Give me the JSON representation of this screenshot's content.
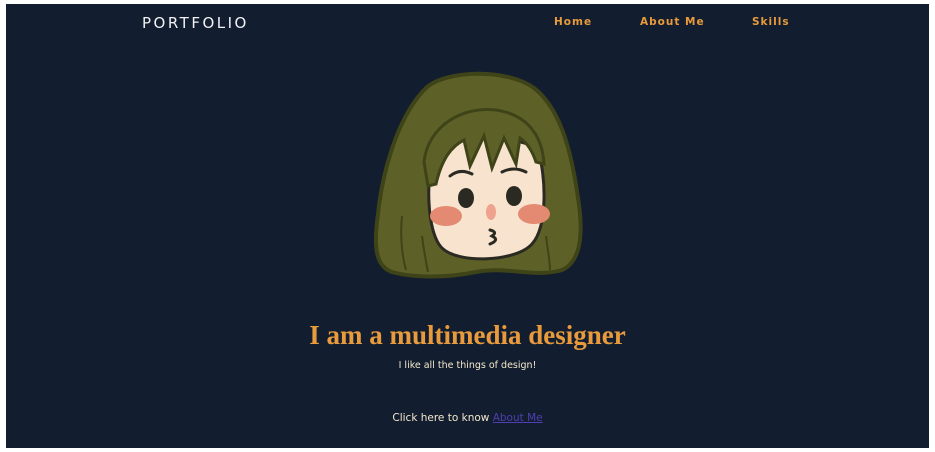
{
  "header": {
    "brand": "PORTFOLIO",
    "nav": [
      {
        "label": "Home"
      },
      {
        "label": "About Me"
      },
      {
        "label": "Skills"
      }
    ]
  },
  "hero": {
    "avatar_icon": "cartoon-girl-avatar",
    "headline": "I am a multimedia designer",
    "subtitle": "I like all the things of design!",
    "cta_prefix": "Click here to know ",
    "cta_link": "About Me"
  },
  "colors": {
    "background": "#121e2f",
    "accent": "#e89a3c",
    "text": "#f4e8cc",
    "link": "#4f3fb0",
    "hair": "#5d6128"
  }
}
